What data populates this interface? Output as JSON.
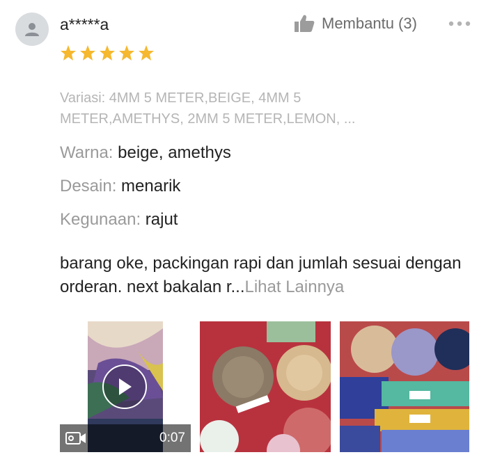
{
  "review": {
    "username": "a*****a",
    "rating": 5,
    "helpful_label": "Membantu (3)",
    "variasi": "Variasi: 4MM 5 METER,BEIGE, 4MM 5 METER,AMETHYS, 2MM 5 METER,LEMON, ...",
    "attributes": [
      {
        "key": "Warna:",
        "value": "beige, amethys"
      },
      {
        "key": "Desain:",
        "value": "menarik"
      },
      {
        "key": "Kegunaan:",
        "value": "rajut"
      }
    ],
    "text": "barang oke, packingan rapi dan jumlah sesuai dengan orderan. next bakalan r...",
    "see_more": "Lihat Lainnya",
    "video_duration": "0:07"
  },
  "colors": {
    "star": "#f5b82e",
    "muted": "#9a9a9a",
    "light_muted": "#b5b5b5"
  },
  "icons": {
    "avatar": "user-icon",
    "helpful": "thumbs-up-icon",
    "more": "more-dots-icon",
    "play": "play-icon",
    "video": "video-camera-icon"
  }
}
